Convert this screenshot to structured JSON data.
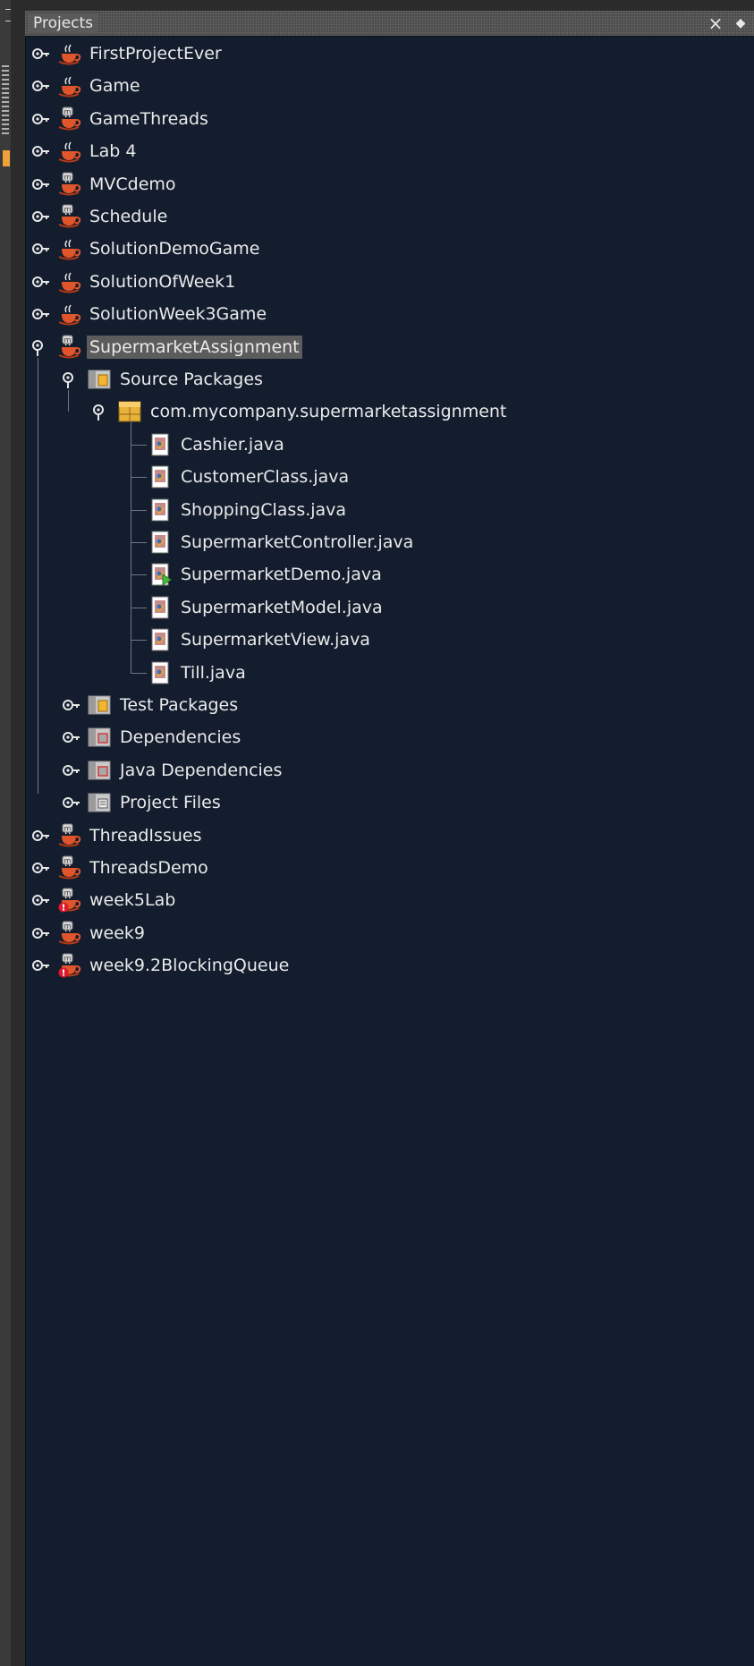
{
  "panel": {
    "title": "Projects"
  },
  "projects": [
    {
      "name": "FirstProjectEver",
      "icon": "java-project-icon"
    },
    {
      "name": "Game",
      "icon": "java-project-icon"
    },
    {
      "name": "GameThreads",
      "icon": "maven-project-icon"
    },
    {
      "name": "Lab 4",
      "icon": "java-project-icon"
    },
    {
      "name": "MVCdemo",
      "icon": "maven-project-icon"
    },
    {
      "name": "Schedule",
      "icon": "maven-project-icon"
    },
    {
      "name": "SolutionDemoGame",
      "icon": "java-project-icon"
    },
    {
      "name": "SolutionOfWeek1",
      "icon": "java-project-icon"
    },
    {
      "name": "SolutionWeek3Game",
      "icon": "java-project-icon"
    },
    {
      "name": "SupermarketAssignment",
      "icon": "maven-project-icon",
      "selected": true,
      "expanded": true
    },
    {
      "name": "ThreadIssues",
      "icon": "maven-project-icon"
    },
    {
      "name": "ThreadsDemo",
      "icon": "maven-project-icon"
    },
    {
      "name": "week5Lab",
      "icon": "maven-project-error-icon"
    },
    {
      "name": "week9",
      "icon": "maven-project-icon"
    },
    {
      "name": "week9.2BlockingQueue",
      "icon": "maven-project-error-icon"
    }
  ],
  "supermarket": {
    "source_packages": "Source Packages",
    "package": "com.mycompany.supermarketassignment",
    "files": [
      "Cashier.java",
      "CustomerClass.java",
      "ShoppingClass.java",
      "SupermarketController.java",
      "SupermarketDemo.java",
      "SupermarketModel.java",
      "SupermarketView.java",
      "Till.java"
    ],
    "other_nodes": [
      "Test Packages",
      "Dependencies",
      "Java Dependencies",
      "Project Files"
    ]
  }
}
